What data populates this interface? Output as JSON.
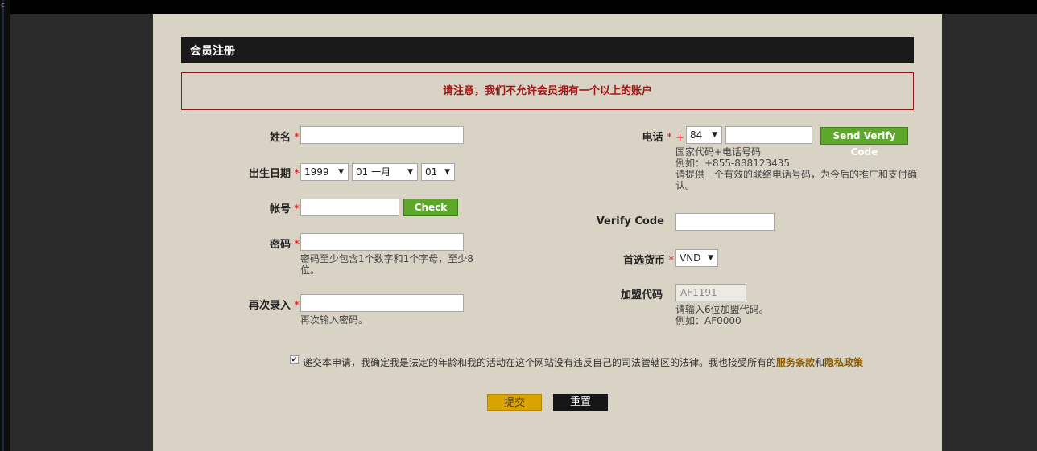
{
  "title": "会员注册",
  "notice": "请注意，我们不允许会员拥有一个以上的账户",
  "left": {
    "name_label": "姓名",
    "dob_label": "出生日期",
    "dob_year": "1999",
    "dob_month": "01 一月",
    "dob_day": "01",
    "account_label": "帐号",
    "check_button": "Check",
    "password_label": "密码",
    "password_hint_1": "密码至少包含1个数字和1个字母，至少8",
    "password_hint_2": "位。",
    "confirm_label": "再次录入",
    "confirm_hint": "再次输入密码。"
  },
  "right": {
    "phone_label": "电话",
    "phone_plus": "+",
    "country_code": "84",
    "send_code_button": "Send Verify Code",
    "phone_hint_1": "国家代码+电话号码",
    "phone_hint_2": "例如：+855-888123435",
    "phone_hint_3": "请提供一个有效的联络电话号码，为今后的推广和支付确",
    "phone_hint_4": "认。",
    "verify_label": "Verify Code",
    "currency_label": "首选货币",
    "currency_value": "VND",
    "affiliate_label": "加盟代码",
    "affiliate_value": "AF1191",
    "affiliate_hint_1": "请输入6位加盟代码。",
    "affiliate_hint_2": "例如：AF0000"
  },
  "required_mark": "*",
  "terms": {
    "text": "递交本申请，我确定我是法定的年龄和我的活动在这个网站没有违反自己的司法管辖区的法律。我也接受所有的",
    "link1": "服务条款",
    "and": "和",
    "link2": "隐私政策"
  },
  "submit_label": "提交",
  "reset_label": "重置",
  "side_mark": "c",
  "colors": {
    "panel": "#d8d3c5",
    "header": "#1a1a1a",
    "notice_text": "#a31515",
    "green_button": "#5da82b",
    "submit": "#d9a300"
  },
  "icons": {
    "dropdown": "dropdown-arrow-icon",
    "checkbox": "checkmark-icon"
  }
}
